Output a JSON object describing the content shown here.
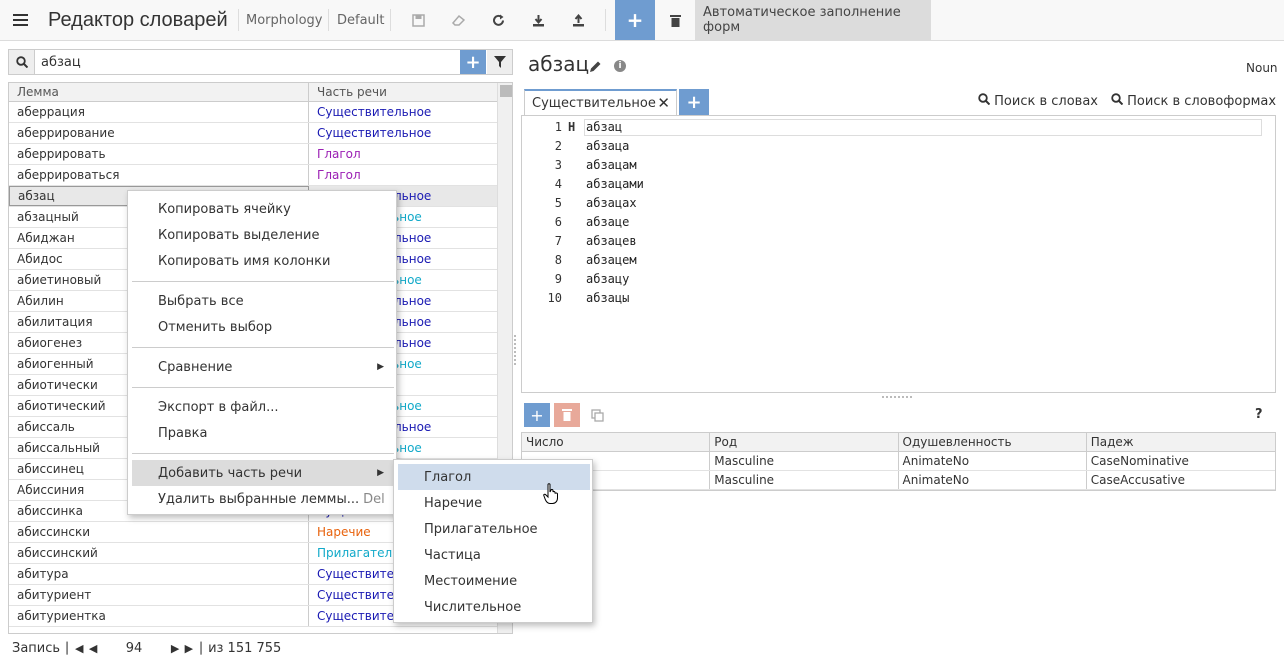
{
  "app": {
    "title": "Редактор словарей",
    "breadcrumb1": "Morphology",
    "breadcrumb2": "Default",
    "autofill_label": "Автоматическое заполнение форм"
  },
  "colors": {
    "accent": "#6f9cd0",
    "noun": "#1a1ab3",
    "verb": "#9b1fb4",
    "adverb": "#e8620c",
    "adjective": "#11a9c9"
  },
  "search": {
    "value": "абзац"
  },
  "grid": {
    "headers": [
      "Лемма",
      "Часть речи"
    ],
    "rows": [
      {
        "lemma": "аберрация",
        "pos": "Существительное",
        "color": "#1a1ab3"
      },
      {
        "lemma": "аберрирование",
        "pos": "Существительное",
        "color": "#1a1ab3"
      },
      {
        "lemma": "аберрировать",
        "pos": "Глагол",
        "color": "#9b1fb4"
      },
      {
        "lemma": "аберрироваться",
        "pos": "Глагол",
        "color": "#9b1fb4"
      },
      {
        "lemma": "абзац",
        "pos": "Существительное",
        "color": "#1a1ab3",
        "selected": true
      },
      {
        "lemma": "абзацный",
        "pos": "Прилагательное",
        "color": "#11a9c9"
      },
      {
        "lemma": "Абиджан",
        "pos": "Существительное",
        "color": "#1a1ab3"
      },
      {
        "lemma": "Абидос",
        "pos": "Существительное",
        "color": "#1a1ab3"
      },
      {
        "lemma": "абиетиновый",
        "pos": "Прилагательное",
        "color": "#11a9c9"
      },
      {
        "lemma": "Абилин",
        "pos": "Существительное",
        "color": "#1a1ab3"
      },
      {
        "lemma": "абилитация",
        "pos": "Существительное",
        "color": "#1a1ab3"
      },
      {
        "lemma": "абиогенез",
        "pos": "Существительное",
        "color": "#1a1ab3"
      },
      {
        "lemma": "абиогенный",
        "pos": "Прилагательное",
        "color": "#11a9c9"
      },
      {
        "lemma": "абиотически",
        "pos": "",
        "color": "#e8620c"
      },
      {
        "lemma": "абиотический",
        "pos": "Прилагательное",
        "color": "#11a9c9"
      },
      {
        "lemma": "абиссаль",
        "pos": "Существительное",
        "color": "#1a1ab3"
      },
      {
        "lemma": "абиссальный",
        "pos": "Прилагательное",
        "color": "#11a9c9"
      },
      {
        "lemma": "абиссинец",
        "pos": "Существительное",
        "color": "#1a1ab3"
      },
      {
        "lemma": "Абиссиния",
        "pos": "Существительное",
        "color": "#1a1ab3"
      },
      {
        "lemma": "абиссинка",
        "pos": "Существительное",
        "color": "#1a1ab3"
      },
      {
        "lemma": "абиссински",
        "pos": "Наречие",
        "color": "#e8620c"
      },
      {
        "lemma": "абиссинский",
        "pos": "Прилагательное",
        "color": "#11a9c9"
      },
      {
        "lemma": "абитура",
        "pos": "Существительное",
        "color": "#1a1ab3"
      },
      {
        "lemma": "абитуриент",
        "pos": "Существительное",
        "color": "#1a1ab3"
      },
      {
        "lemma": "абитуриентка",
        "pos": "Существительное",
        "color": "#1a1ab3"
      }
    ]
  },
  "pager": {
    "label": "Запись",
    "current": "94",
    "total": "из 151 755"
  },
  "context_menu": {
    "items": [
      {
        "label": "Копировать ячейку"
      },
      {
        "label": "Копировать выделение"
      },
      {
        "label": "Копировать имя колонки"
      },
      {
        "label": "Выбрать все"
      },
      {
        "label": "Отменить выбор"
      },
      {
        "label": "Сравнение",
        "submenu": true
      },
      {
        "label": "Экспорт в файл..."
      },
      {
        "label": "Правка"
      },
      {
        "label": "Добавить часть речи",
        "submenu": true,
        "highlighted": true
      },
      {
        "label": "Удалить выбранные леммы...",
        "hint": "Del"
      }
    ]
  },
  "submenu": {
    "items": [
      "Глагол",
      "Наречие",
      "Прилагательное",
      "Частица",
      "Местоимение",
      "Числительное"
    ]
  },
  "detail": {
    "lemma": "абзац",
    "pos_code": "Noun",
    "tab_label": "Существительное",
    "search_words": "Поиск в словах",
    "search_forms": "Поиск в словоформах",
    "forms": [
      {
        "n": "1",
        "mark": "Н",
        "text": "абзац"
      },
      {
        "n": "2",
        "mark": "",
        "text": "абзаца"
      },
      {
        "n": "3",
        "mark": "",
        "text": "абзацам"
      },
      {
        "n": "4",
        "mark": "",
        "text": "абзацами"
      },
      {
        "n": "5",
        "mark": "",
        "text": "абзацах"
      },
      {
        "n": "6",
        "mark": "",
        "text": "абзаце"
      },
      {
        "n": "7",
        "mark": "",
        "text": "абзацев"
      },
      {
        "n": "8",
        "mark": "",
        "text": "абзацем"
      },
      {
        "n": "9",
        "mark": "",
        "text": "абзацу"
      },
      {
        "n": "10",
        "mark": "",
        "text": "абзацы"
      }
    ],
    "help": "?",
    "grammemes": {
      "headers": [
        "Число",
        "Род",
        "Одушевленность",
        "Падеж"
      ],
      "rows": [
        [
          "",
          "Masculine",
          "AnimateNo",
          "CaseNominative"
        ],
        [
          "",
          "Masculine",
          "AnimateNo",
          "CaseAccusative"
        ]
      ]
    }
  }
}
